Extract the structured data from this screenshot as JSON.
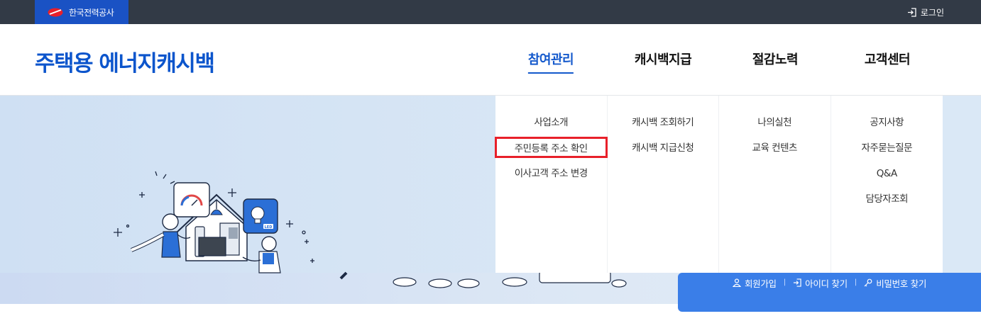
{
  "topbar": {
    "org_name": "한국전력공사",
    "login_label": "로그인",
    "icons": {
      "logo": "kepco-logo-icon",
      "login": "login-icon"
    }
  },
  "header": {
    "site_title": "주택용 에너지캐시백",
    "nav": [
      {
        "label": "참여관리",
        "active": true
      },
      {
        "label": "캐시백지급",
        "active": false
      },
      {
        "label": "절감노력",
        "active": false
      },
      {
        "label": "고객센터",
        "active": false
      }
    ],
    "accent_color": "#1459cc"
  },
  "mega_menu": {
    "columns": [
      [
        "사업소개",
        "주민등록 주소 확인",
        "이사고객 주소 변경"
      ],
      [
        "캐시백 조회하기",
        "캐시백 지급신청"
      ],
      [
        "나의실천",
        "교육 컨텐츠"
      ],
      [
        "공지사항",
        "자주묻는질문",
        "Q&A",
        "담당자조회"
      ]
    ],
    "highlighted": "주민등록 주소 확인",
    "highlight_color": "#e8202a"
  },
  "member_box": {
    "signup": "회원가입",
    "find_id": "아이디 찾기",
    "find_pw": "비밀번호 찾기",
    "icons": {
      "signup": "person-icon",
      "find_id": "login-icon",
      "find_pw": "key-icon"
    },
    "color": "#3a7ee8"
  },
  "hero": {
    "illustration": "smart-home-illustration",
    "illustration_text": "LED"
  }
}
